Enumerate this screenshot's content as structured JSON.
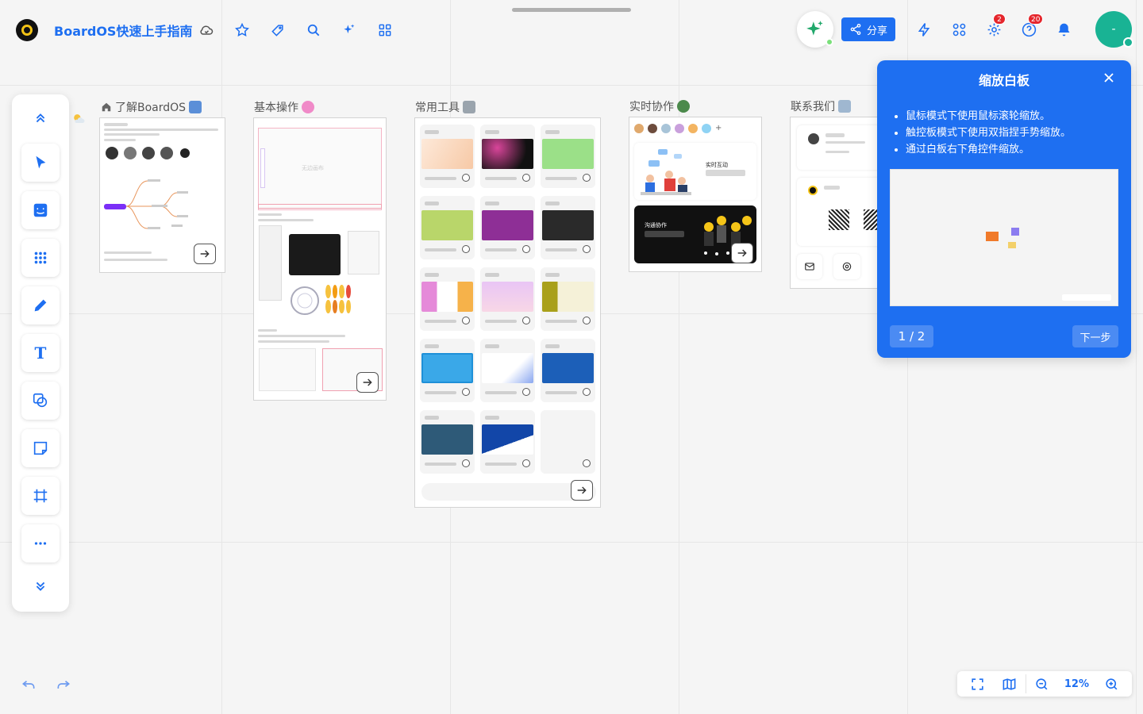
{
  "board": {
    "title": "BoardOS快速上手指南"
  },
  "topbar": {
    "share_label": "分享",
    "notif_badge_1": "2",
    "notif_badge_2": "20",
    "avatar_text": "-"
  },
  "frames": [
    {
      "title": "了解BoardOS"
    },
    {
      "title": "基本操作"
    },
    {
      "title": "常用工具"
    },
    {
      "title": "实时协作"
    },
    {
      "title": "联系我们"
    }
  ],
  "collab_card": {
    "label_1": "实时互动",
    "label_2": "沟通协作"
  },
  "basic_ops": {
    "canvas_hint": "无边画布"
  },
  "panel": {
    "title": "缩放白板",
    "tips": [
      "鼠标模式下使用鼠标滚轮缩放。",
      "触控板模式下使用双指捏手势缩放。",
      "通过白板右下角控件缩放。"
    ],
    "page_indicator": "1 / 2",
    "next_label": "下一步"
  },
  "zoom": {
    "value": "12%"
  },
  "colors": {
    "accent": "#1e6ff1",
    "avatar": "#19b394",
    "badge": "#e5262c"
  }
}
